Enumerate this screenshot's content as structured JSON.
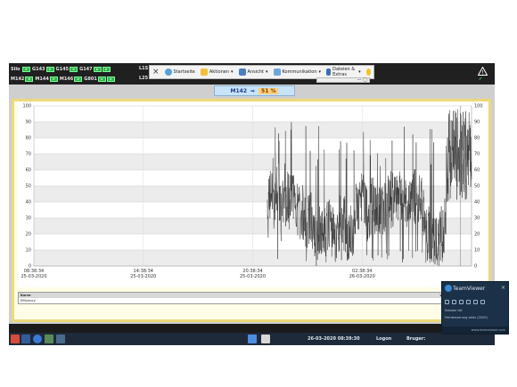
{
  "status_bar": {
    "row1": [
      {
        "label": "Silo",
        "items": []
      },
      {
        "label": "G143",
        "items": []
      },
      {
        "label": "G145",
        "items": []
      },
      {
        "label": "G147",
        "items": []
      }
    ],
    "row2": [
      {
        "label": "M142"
      },
      {
        "label": "M144"
      },
      {
        "label": "M146"
      },
      {
        "label": "G801"
      }
    ],
    "trunc_top": "L1S",
    "trunc_bottom": "L25",
    "indicator_text": "P"
  },
  "teamviewer_toolbar": {
    "close": "×",
    "items": [
      {
        "label": "Startseite",
        "icon": "home-icon"
      },
      {
        "label": "Aktionen",
        "icon": "lightning-icon"
      },
      {
        "label": "Ansicht",
        "icon": "monitor-icon"
      },
      {
        "label": "Kommunikation",
        "icon": "chat-icon"
      },
      {
        "label": "Dateien & Extras",
        "icon": "files-icon"
      }
    ],
    "sub_text": "G80L"
  },
  "badge": {
    "machine": "M142",
    "value": "51 %"
  },
  "chart_data": {
    "type": "line",
    "ylim": [
      0,
      100
    ],
    "yticks": [
      "100",
      "90",
      "80",
      "70",
      "60",
      "50",
      "40",
      "30",
      "20",
      "10",
      "0"
    ],
    "xticks": [
      {
        "time": "08:38:34",
        "date": "25-03-2020"
      },
      {
        "time": "14:38:34",
        "date": "25-03-2020"
      },
      {
        "time": "20:38:34",
        "date": "25-03-2020"
      },
      {
        "time": "02:38:34",
        "date": "26-03-2020"
      }
    ],
    "x_start": "25-03-2020 08:38:34",
    "x_end": "26-03-2020 08:39:30",
    "data_start_hours": 12.8,
    "series": [
      {
        "color": "#3a3a3a"
      }
    ]
  },
  "datatable": {
    "head_left": "Kurve",
    "head_right": "Variabel Zeitstempe Wert",
    "row_left": "Efficiency",
    "row_right": "Efficiency_SpillD_Aus..."
  },
  "taskbar": {
    "datetime": "26-03-2020 08:39:30",
    "logon": "Logon",
    "user": "Bruger:"
  },
  "teamviewer_popup": {
    "title": "TeamViewer",
    "close": "×",
    "line1": "Session list",
    "line2": "Fernsteuerung aktiv (2020)",
    "footer": "www.teamviewer.com"
  }
}
